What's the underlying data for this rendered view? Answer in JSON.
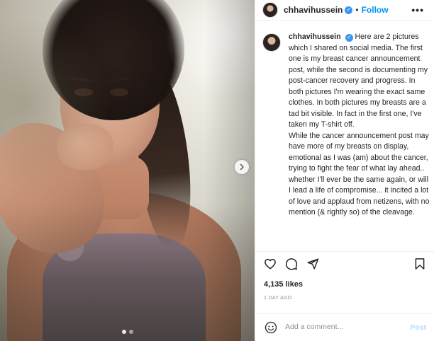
{
  "post": {
    "username": "chhavihussein",
    "follow_label": "Follow",
    "separator": "•",
    "more_label": "•••",
    "caption": "Here are 2 pictures which I shared on social media. The first one is my breast cancer announcement post, while the second is documenting my post-cancer recovery and progress. In both pictures I'm wearing the exact same clothes. In both pictures my breasts are a tad bit visible. In fact in the first one, I've taken my T-shirt off.\nWhile the cancer announcement post may have more of my breasts on display, emotional as I was (am) about the cancer, trying to fight the fear of what lay ahead.. whether I'll ever be the same again, or will I lead a life of compromise... it incited a lot of love and applaud from netizens, with no mention (& rightly so) of the cleavage.",
    "likes": "4,135 likes",
    "time": "1 DAY AGO"
  },
  "carousel": {
    "total_slides": 2,
    "current_slide": 1
  },
  "comment": {
    "placeholder": "Add a comment...",
    "post_label": "Post"
  },
  "icons": {
    "verified": "verified-badge-icon",
    "like": "heart-icon",
    "comment": "comment-icon",
    "share": "share-icon",
    "save": "bookmark-icon",
    "emoji": "emoji-icon",
    "next": "chevron-right-icon"
  },
  "colors": {
    "link": "#0095f6",
    "verified": "#3897f0",
    "muted": "#8e8e8e"
  }
}
